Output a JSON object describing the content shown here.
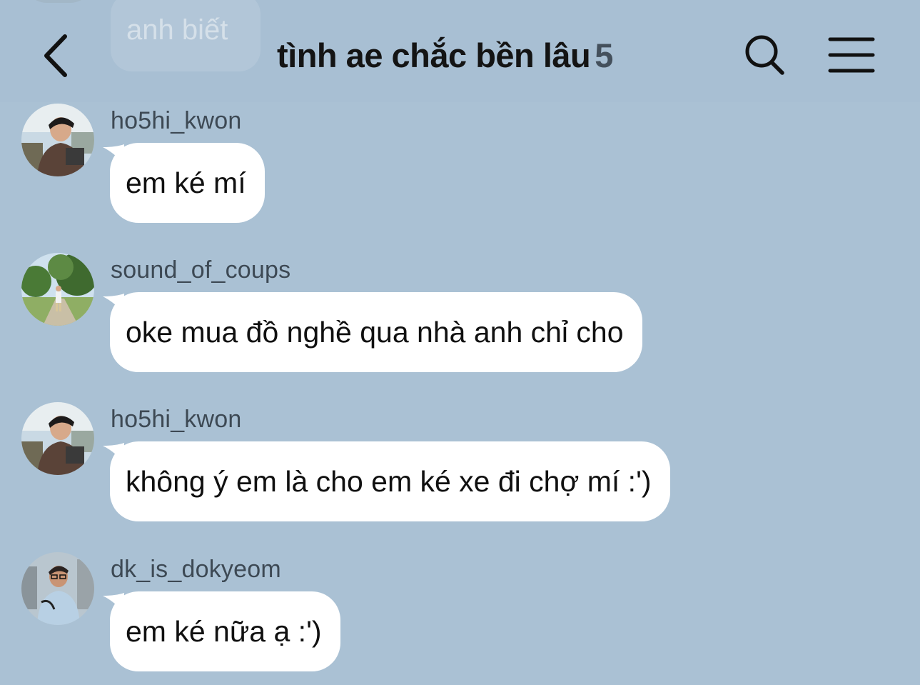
{
  "header": {
    "title": "tình ae chắc bền lâu",
    "member_count": "5",
    "icons": {
      "back": "chevron-left-icon",
      "search": "search-icon",
      "menu": "hamburger-menu-icon"
    }
  },
  "previous_message": {
    "text": "anh biết"
  },
  "colors": {
    "background": "#aac1d4",
    "bubble": "#ffffff",
    "username": "#3d4954"
  },
  "messages": [
    {
      "username": "ho5hi_kwon",
      "text": "em ké mí"
    },
    {
      "username": "sound_of_coups",
      "text": "oke mua đồ nghề qua nhà anh chỉ cho"
    },
    {
      "username": "ho5hi_kwon",
      "text": "không ý em là cho em ké xe đi chợ mí :')"
    },
    {
      "username": "dk_is_dokyeom",
      "text": "em ké nữa ạ :')"
    }
  ]
}
